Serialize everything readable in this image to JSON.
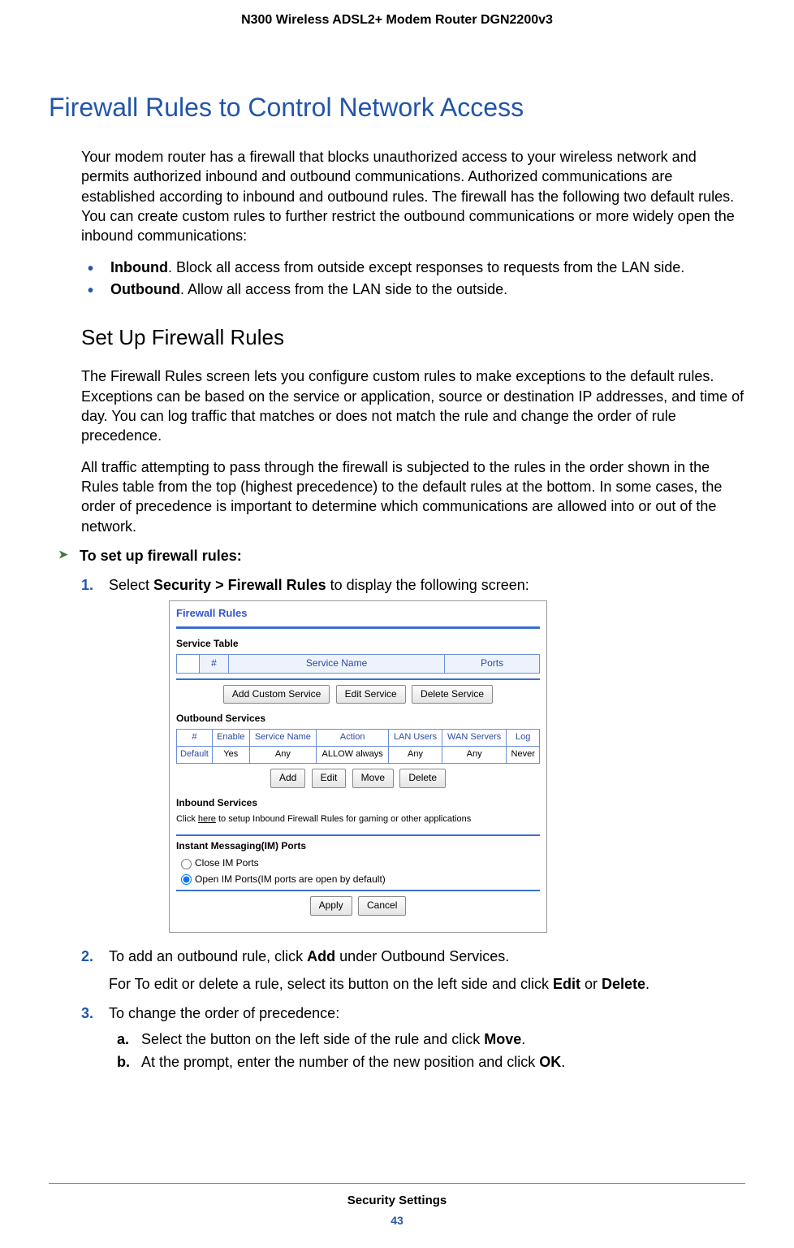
{
  "header": {
    "running_title": "N300 Wireless ADSL2+ Modem Router DGN2200v3"
  },
  "h1": "Firewall Rules to Control Network Access",
  "intro": "Your modem router has a firewall that blocks unauthorized access to your wireless network and permits authorized inbound and outbound communications. Authorized communications are established according to inbound and outbound rules. The firewall has the following two default rules. You can create custom rules to further restrict the outbound communications or more widely open the inbound communications:",
  "bullets": {
    "inbound_bold": "Inbound",
    "inbound_rest": ". Block all access from outside except responses to requests from the LAN side.",
    "outbound_bold": "Outbound",
    "outbound_rest": ". Allow all access from the LAN side to the outside."
  },
  "h2": "Set Up Firewall Rules",
  "para2": "The Firewall Rules screen lets you configure custom rules to make exceptions to the default rules. Exceptions can be based on the service or application, source or destination IP addresses, and time of day. You can log traffic that matches or does not match the rule and change the order of rule precedence.",
  "para3": "All traffic attempting to pass through the firewall is subjected to the rules in the order shown in the Rules table from the top (highest precedence) to the default rules at the bottom. In some cases, the order of precedence is important to determine which communications are allowed into or out of the network.",
  "task": "To set up firewall rules:",
  "steps": {
    "1": {
      "n": "1.",
      "pre": "Select ",
      "bold": "Security > Firewall Rules",
      "post": " to display the following screen:"
    },
    "2": {
      "n": "2.",
      "pre": "To add an outbound rule, click ",
      "bold": "Add",
      "post": " under Outbound Services.",
      "sub": {
        "pre": "For To edit or delete a rule, select its button on the left side and click ",
        "b1": "Edit",
        "mid": " or ",
        "b2": "Delete",
        "post": "."
      }
    },
    "3": {
      "n": "3.",
      "text": "To change the order of precedence:",
      "a": {
        "m": "a.",
        "pre": "Select the button on the left side of the rule and click ",
        "b": "Move",
        "post": "."
      },
      "b": {
        "m": "b.",
        "pre": "At the prompt, enter the number of the new position and click ",
        "b": "OK",
        "post": "."
      }
    }
  },
  "ui": {
    "title": "Firewall Rules",
    "service_table": "Service Table",
    "svc_cols": {
      "hash": "#",
      "name": "Service Name",
      "ports": "Ports"
    },
    "svc_btns": {
      "add": "Add Custom Service",
      "edit": "Edit Service",
      "del": "Delete Service"
    },
    "outbound": "Outbound Services",
    "ob_cols": {
      "hash": "#",
      "enable": "Enable",
      "name": "Service Name",
      "action": "Action",
      "lan": "LAN Users",
      "wan": "WAN Servers",
      "log": "Log"
    },
    "ob_row": {
      "hash": "Default",
      "enable": "Yes",
      "name": "Any",
      "action": "ALLOW always",
      "lan": "Any",
      "wan": "Any",
      "log": "Never"
    },
    "ob_btns": {
      "add": "Add",
      "edit": "Edit",
      "move": "Move",
      "del": "Delete"
    },
    "inbound": "Inbound Services",
    "inbound_hint_pre": "Click ",
    "inbound_hint_link": "here",
    "inbound_hint_post": " to setup Inbound Firewall Rules for gaming or other applications",
    "im": "Instant Messaging(IM) Ports",
    "im_close": "Close IM Ports",
    "im_open": "Open IM Ports(IM ports are open by default)",
    "apply": "Apply",
    "cancel": "Cancel"
  },
  "footer": {
    "section": "Security Settings",
    "page": "43"
  }
}
